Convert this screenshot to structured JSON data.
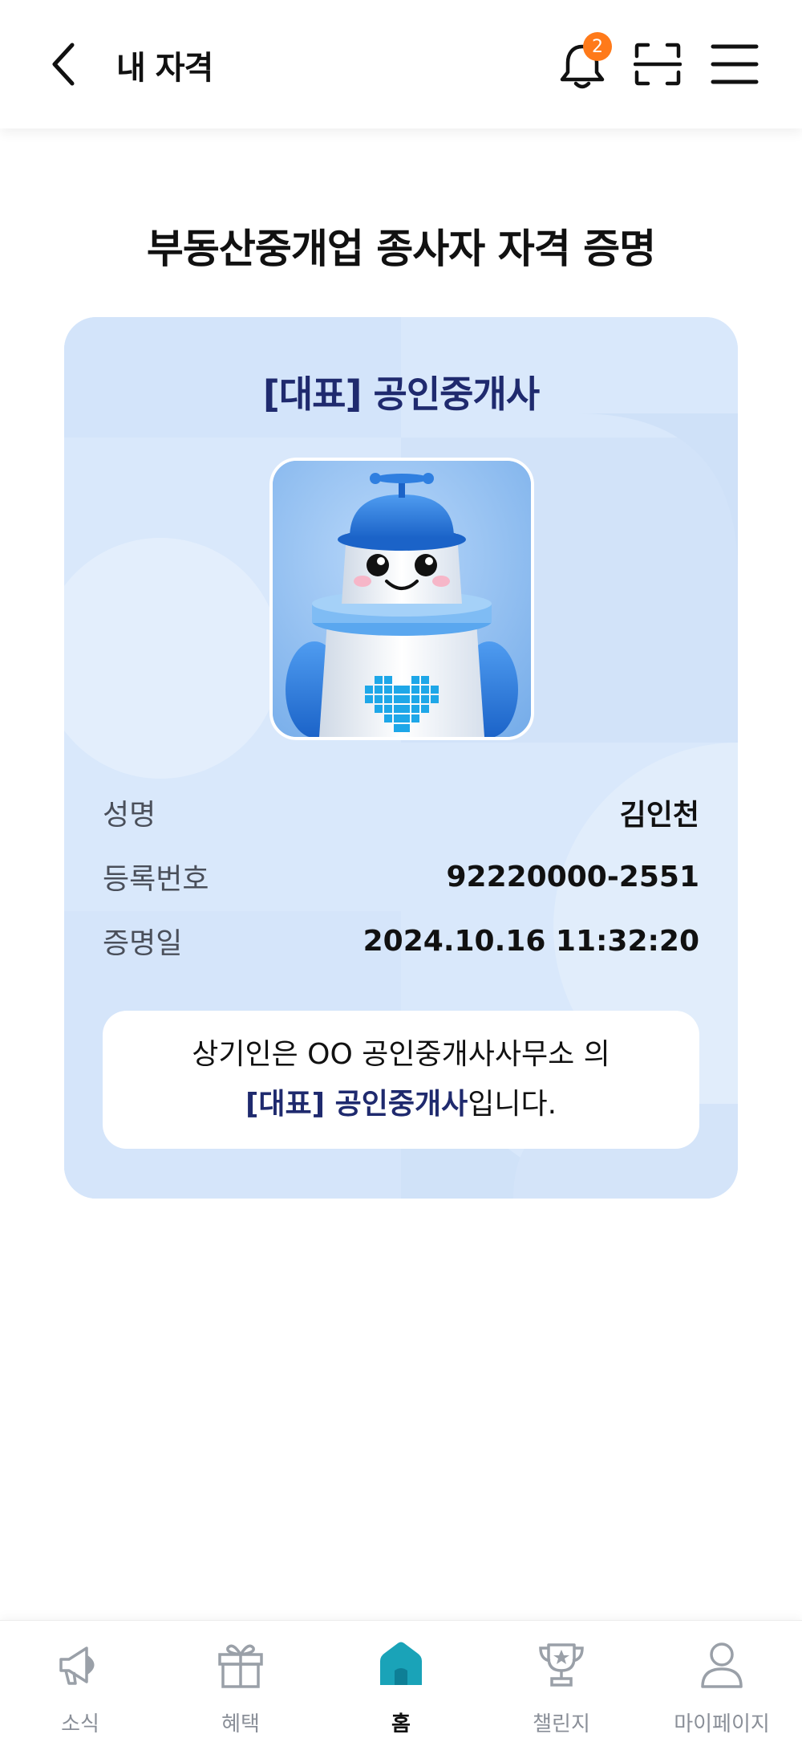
{
  "header": {
    "title": "내 자격",
    "notification_count": "2"
  },
  "page_title": "부동산중개업 종사자 자격 증명",
  "card": {
    "cert_title": "[대표] 공인중개사",
    "rows": [
      {
        "label": "성명",
        "value": "김인천"
      },
      {
        "label": "등록번호",
        "value": "92220000-2551"
      },
      {
        "label": "증명일",
        "value": "2024.10.16 11:32:20"
      }
    ],
    "statement_line1": "상기인은 OO 공인중개사사무소 의",
    "statement_line2_highlight": "[대표] 공인중개사",
    "statement_line2_suffix": "입니다."
  },
  "bottom_nav": [
    {
      "label": "소식",
      "icon": "megaphone-icon",
      "active": false
    },
    {
      "label": "혜택",
      "icon": "gift-icon",
      "active": false
    },
    {
      "label": "홈",
      "icon": "home-icon",
      "active": true
    },
    {
      "label": "챌린지",
      "icon": "trophy-icon",
      "active": false
    },
    {
      "label": "마이페이지",
      "icon": "person-icon",
      "active": false
    }
  ],
  "colors": {
    "accent_navy": "#1f2a6e",
    "badge_orange": "#ff7a1a",
    "home_teal": "#1aa3b8",
    "card_bg": "#dbe9fb"
  }
}
